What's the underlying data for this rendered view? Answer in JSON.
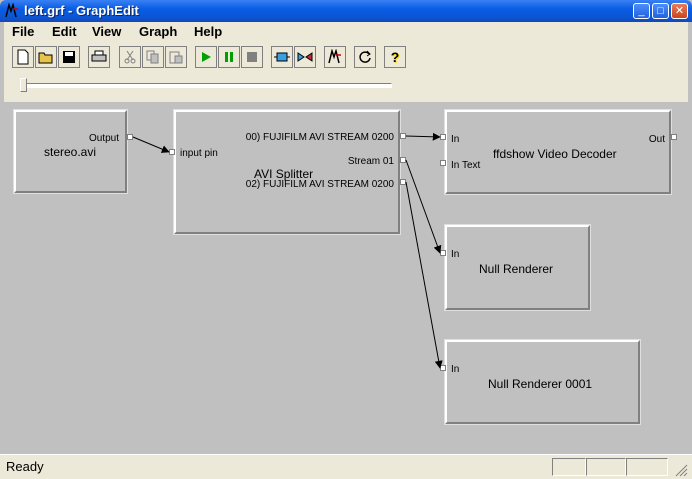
{
  "window": {
    "title": "left.grf - GraphEdit"
  },
  "menu": [
    "File",
    "Edit",
    "View",
    "Graph",
    "Help"
  ],
  "toolbar": [
    {
      "icon": "new-icon"
    },
    {
      "icon": "open-icon"
    },
    {
      "icon": "save-icon"
    },
    {
      "icon": "print-icon"
    },
    {
      "icon": "cut-icon"
    },
    {
      "icon": "copy-icon"
    },
    {
      "icon": "paste-icon"
    },
    {
      "icon": "play-icon"
    },
    {
      "icon": "pause-icon"
    },
    {
      "icon": "stop-icon"
    },
    {
      "icon": "seek-icon"
    },
    {
      "icon": "frame-step-icon"
    },
    {
      "icon": "mute-icon"
    },
    {
      "icon": "refresh-icon"
    },
    {
      "icon": "help-icon"
    }
  ],
  "seek": {
    "position": 0
  },
  "filters": {
    "source": {
      "name": "stereo.avi",
      "pins": [
        "Output"
      ]
    },
    "splitter": {
      "name": "AVI Splitter",
      "pins": [
        "input pin",
        "00) FUJIFILM AVI STREAM 0200",
        "Stream 01",
        "02) FUJIFILM AVI STREAM 0200"
      ]
    },
    "decoder": {
      "name": "ffdshow Video Decoder",
      "pins": [
        "In",
        "In Text",
        "Out"
      ]
    },
    "null1": {
      "name": "Null Renderer",
      "pins": [
        "In"
      ]
    },
    "null2": {
      "name": "Null Renderer 0001",
      "pins": [
        "In"
      ]
    }
  },
  "status": {
    "text": "Ready"
  },
  "colors": {
    "titlebar": "#0a5de5",
    "canvas": "#c0c0c0",
    "green_play": "#00a000"
  }
}
